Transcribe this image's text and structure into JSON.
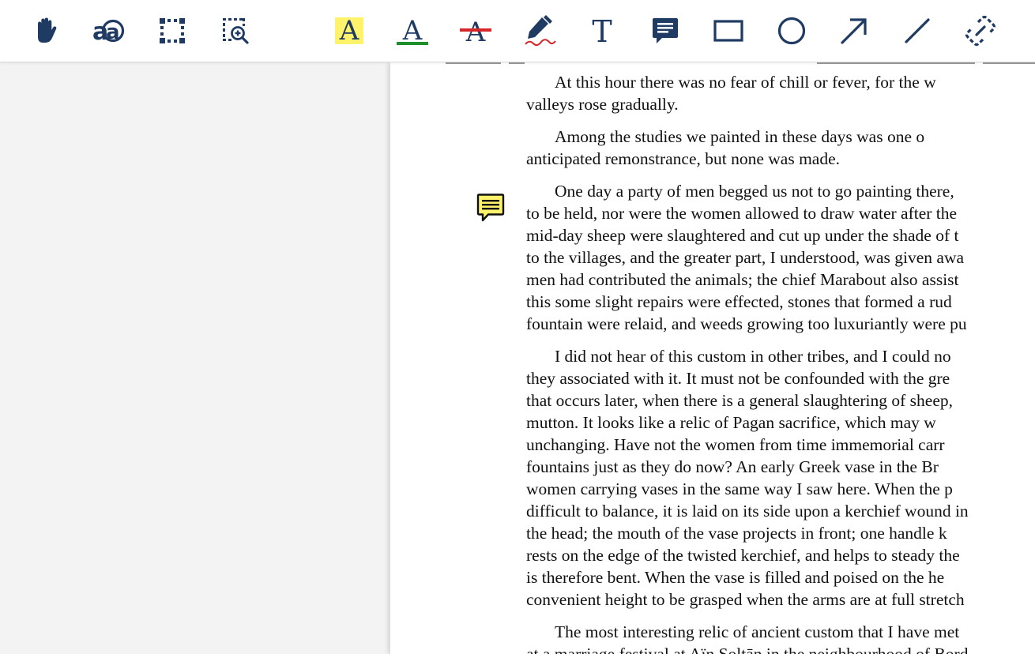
{
  "toolbar": {
    "tools": [
      {
        "name": "pan-tool",
        "icon": "hand-icon"
      },
      {
        "name": "text-select-tool",
        "icon": "text-select-icon"
      },
      {
        "name": "area-select-tool",
        "icon": "marquee-icon"
      },
      {
        "name": "zoom-area-tool",
        "icon": "zoom-area-icon"
      },
      {
        "name": "highlight-tool",
        "icon": "highlight-text-icon",
        "glyph": "A"
      },
      {
        "name": "underline-tool",
        "icon": "underline-text-icon",
        "glyph": "A"
      },
      {
        "name": "strikeout-tool",
        "icon": "strikeout-text-icon",
        "glyph": "A"
      },
      {
        "name": "freehand-tool",
        "icon": "pen-icon"
      },
      {
        "name": "free-text-tool",
        "icon": "text-icon",
        "glyph": "T"
      },
      {
        "name": "sticky-note-tool",
        "icon": "comment-icon"
      },
      {
        "name": "rectangle-tool",
        "icon": "rectangle-icon"
      },
      {
        "name": "ellipse-tool",
        "icon": "circle-icon"
      },
      {
        "name": "arrow-tool",
        "icon": "arrow-icon"
      },
      {
        "name": "line-tool",
        "icon": "line-icon"
      },
      {
        "name": "link-tool",
        "icon": "link-icon"
      }
    ],
    "colors": {
      "icon": "#1f3b63",
      "highlight": "#fff36b",
      "underline": "#1a8f2a",
      "strikeout": "#d6262b",
      "pen_stroke": "#d6262b"
    }
  },
  "document": {
    "paragraphs": [
      {
        "lines": [
          "At this hour there was no fear of chill or fever, for the w",
          "valleys rose gradually."
        ]
      },
      {
        "lines": [
          "Among the studies we painted in these days was one o",
          "anticipated remonstrance, but none was made."
        ]
      },
      {
        "lines": [
          "One day a party of men begged us not to go painting there,",
          "to be held, nor were the women allowed to draw water after the",
          "mid-day sheep were slaughtered and cut up under the shade of t",
          "to the villages, and the greater part, I understood, was given awa",
          "men had contributed the animals; the chief Marabout also assist",
          "this some slight repairs were effected, stones that formed a rud",
          "fountain were relaid, and weeds growing too luxuriantly were pu"
        ]
      },
      {
        "lines": [
          "I did not hear of this custom in other tribes, and I could no",
          "they associated with it. It must not be confounded with the gre",
          "that occurs later, when there is a general slaughtering of sheep,",
          "mutton. It looks like a relic of Pagan sacrifice, which may w",
          "unchanging. Have not the women from time immemorial carr",
          "fountains just as they do now? An early Greek vase in the Br",
          "women carrying vases in the same way I saw here. When the p",
          "difficult to balance, it is laid on its side upon a kerchief wound in",
          "the head; the mouth of the vase projects in front; one handle k",
          "rests on the edge of the twisted kerchief, and helps to steady the",
          "is therefore bent. When the vase is filled and poised on the he",
          "convenient height to be grasped when the arms are at full stretch"
        ]
      },
      {
        "lines": [
          "The most interesting relic of ancient custom that I have met",
          "at a marriage festival at Aïn Soltān in the neighbourhood of Bord"
        ]
      }
    ],
    "annotation": {
      "icon": "sticky-note-icon",
      "fill": "#fff36b"
    }
  }
}
